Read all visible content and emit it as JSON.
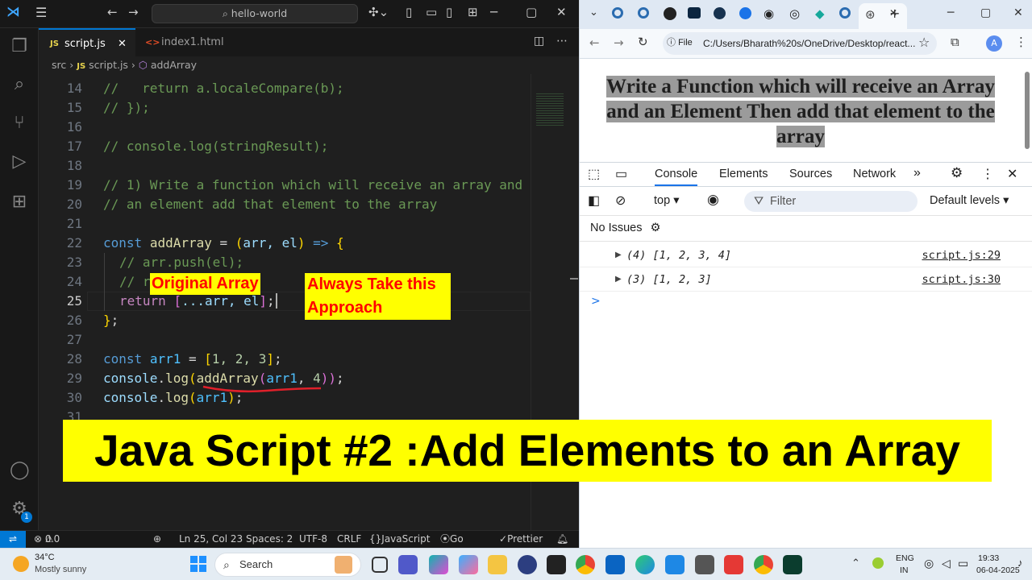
{
  "vscode": {
    "search_text": "hello-world",
    "tabs": [
      {
        "label": "script.js",
        "icon": "JS"
      },
      {
        "label": "index1.html",
        "icon": "<>"
      }
    ],
    "breadcrumb": {
      "folder": "src",
      "file": "script.js",
      "symbol": "addArray"
    },
    "lines": [
      {
        "n": "14"
      },
      {
        "n": "15"
      },
      {
        "n": "16"
      },
      {
        "n": "17"
      },
      {
        "n": "18"
      },
      {
        "n": "19"
      },
      {
        "n": "20"
      },
      {
        "n": "21"
      },
      {
        "n": "22"
      },
      {
        "n": "23"
      },
      {
        "n": "24"
      },
      {
        "n": "25"
      },
      {
        "n": "26"
      },
      {
        "n": "27"
      },
      {
        "n": "28"
      },
      {
        "n": "29"
      },
      {
        "n": "30"
      },
      {
        "n": "31"
      }
    ],
    "code": {
      "l14": "//   return a.localeCompare(b);",
      "l15": "// });",
      "l17": "// console.log(stringResult);",
      "l19": "// 1) Write a function which will receive an array and",
      "l20": "// an element add that element to the array",
      "l22_kw": "const",
      "l22_fn": "addArray",
      "l22_eq": " = ",
      "l22_p1": "(",
      "l22_params": "arr, el",
      "l22_p2": ")",
      "l22_arrow": " => ",
      "l22_br": "{",
      "l23": "// arr.push(el);",
      "l24": "// return arr;",
      "l25_kw": "return",
      "l25_b1": "[",
      "l25_body": "...arr, el",
      "l25_b2": "]",
      "l25_end": ";",
      "l26_br": "}",
      "l26_end": ";",
      "l28_kw": "const",
      "l28_var": "arr1",
      "l28_eq": " = ",
      "l28_b1": "[",
      "l28_vals": "1, 2, 3",
      "l28_b2": "]",
      "l28_end": ";",
      "l29_obj": "console",
      "l29_dot": ".",
      "l29_fn": "log",
      "l29_p1": "(",
      "l29_call": "addArray",
      "l29_p2": "(",
      "l29_arg": "arr1",
      "l29_sep": ", ",
      "l29_num": "4",
      "l29_p3": "))",
      "l29_end": ";",
      "l30_obj": "console",
      "l30_dot": ".",
      "l30_fn": "log",
      "l30_p1": "(",
      "l30_arg": "arr1",
      "l30_p2": ")",
      "l30_end": ";"
    },
    "note": "Always Take this Approach",
    "status": {
      "errors": "0",
      "warnings": "0",
      "position": "Ln 25, Col 23",
      "spaces": "Spaces: 2",
      "encoding": "UTF-8",
      "eol": "CRLF",
      "language": "JavaScript",
      "live": "Go Live",
      "prettier": "Prettier"
    },
    "notification_count": "1"
  },
  "browser": {
    "file_badge": "File",
    "url": "C:/Users/Bharath%20s/OneDrive/Desktop/react...",
    "profile_initial": "A",
    "page_heading": "Write a Function which will receive an Array and an Element Then add that element to the array",
    "devtools": {
      "tabs": [
        "Console",
        "Elements",
        "Sources",
        "Network"
      ],
      "context": "top",
      "filter_placeholder": "Filter",
      "levels": "Default levels",
      "issues": "No Issues",
      "logs": [
        {
          "message": "(4) [1, 2, 3, 4]",
          "source": "script.js:29"
        },
        {
          "message": "(3) [1, 2, 3]",
          "source": "script.js:30"
        }
      ],
      "prompt": ">",
      "note": "Original Array"
    }
  },
  "banner": "Java Script #2 :Add Elements to an Array",
  "taskbar": {
    "weather_temp": "34°C",
    "weather_desc": "Mostly sunny",
    "search_label": "Search",
    "lang_line1": "ENG",
    "lang_line2": "IN",
    "time": "19:33",
    "date": "06-04-2025"
  },
  "colors": {
    "banner_bg": "#ffff00",
    "note_text": "#ff0000",
    "vscode_accent": "#0078d4"
  }
}
